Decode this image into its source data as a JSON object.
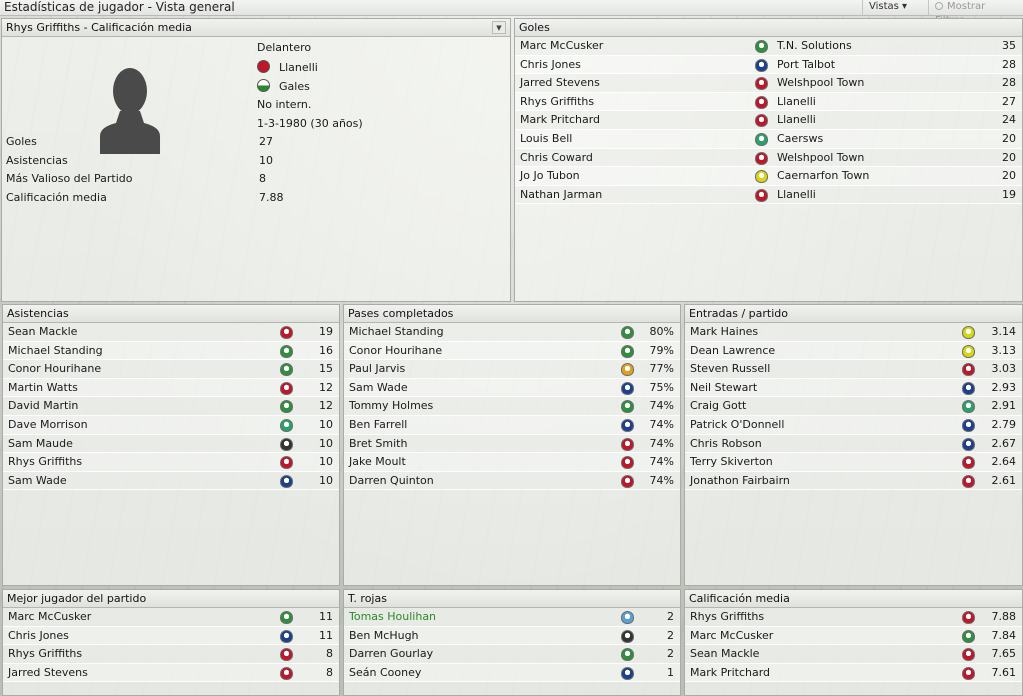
{
  "window": {
    "title": "Estadísticas de jugador - Vista general"
  },
  "toolbar": {
    "vistas_label": "Vistas ▾",
    "filters_label": "Mostrar Filtros"
  },
  "player_panel": {
    "header": "Rhys Griffiths - Calificación media",
    "position": "Delantero",
    "club": "Llanelli",
    "nation": "Gales",
    "intl": "No intern.",
    "dob": "1-3-1980 (30 años)",
    "stats": [
      {
        "label": "Goles",
        "value": "27"
      },
      {
        "label": "Asistencias",
        "value": "10"
      },
      {
        "label": "Más Valioso del Partido",
        "value": "8"
      },
      {
        "label": "Calificación media",
        "value": "7.88"
      }
    ]
  },
  "goals_panel": {
    "header": "Goles",
    "rows": [
      {
        "name": "Marc McCusker",
        "club": "T.N. Solutions",
        "value": "35",
        "color": "#2f8f3f"
      },
      {
        "name": "Chris Jones",
        "club": "Port Talbot",
        "value": "28",
        "color": "#1c3f8f"
      },
      {
        "name": "Jarred Stevens",
        "club": "Welshpool Town",
        "value": "28",
        "color": "#c0162a"
      },
      {
        "name": "Rhys Griffiths",
        "club": "Llanelli",
        "value": "27",
        "color": "#c0162a"
      },
      {
        "name": "Mark Pritchard",
        "club": "Llanelli",
        "value": "24",
        "color": "#c0162a"
      },
      {
        "name": "Louis Bell",
        "club": "Caersws",
        "value": "20",
        "color": "#2aa06a"
      },
      {
        "name": "Chris Coward",
        "club": "Welshpool Town",
        "value": "20",
        "color": "#c0162a"
      },
      {
        "name": "Jo Jo Tubon",
        "club": "Caernarfon Town",
        "value": "20",
        "color": "#d6d614"
      },
      {
        "name": "Nathan Jarman",
        "club": "Llanelli",
        "value": "19",
        "color": "#c0162a"
      }
    ]
  },
  "assists_panel": {
    "header": "Asistencias",
    "rows": [
      {
        "name": "Sean Mackle",
        "value": "19",
        "color": "#c0162a"
      },
      {
        "name": "Michael Standing",
        "value": "16",
        "color": "#2f8f3f"
      },
      {
        "name": "Conor Hourihane",
        "value": "15",
        "color": "#2f8f3f"
      },
      {
        "name": "Martin Watts",
        "value": "12",
        "color": "#c0162a"
      },
      {
        "name": "David Martin",
        "value": "12",
        "color": "#2f8f3f"
      },
      {
        "name": "Dave Morrison",
        "value": "10",
        "color": "#2aa06a"
      },
      {
        "name": "Sam Maude",
        "value": "10",
        "color": "#333333"
      },
      {
        "name": "Rhys Griffiths",
        "value": "10",
        "color": "#c0162a"
      },
      {
        "name": "Sam Wade",
        "value": "10",
        "color": "#1c3f8f"
      }
    ]
  },
  "passes_panel": {
    "header": "Pases completados",
    "rows": [
      {
        "name": "Michael Standing",
        "value": "80%",
        "color": "#2f8f3f"
      },
      {
        "name": "Conor Hourihane",
        "value": "79%",
        "color": "#2f8f3f"
      },
      {
        "name": "Paul Jarvis",
        "value": "77%",
        "color": "#e0a020"
      },
      {
        "name": "Sam Wade",
        "value": "75%",
        "color": "#1c3f8f"
      },
      {
        "name": "Tommy Holmes",
        "value": "74%",
        "color": "#2f8f3f"
      },
      {
        "name": "Ben Farrell",
        "value": "74%",
        "color": "#1c3f8f"
      },
      {
        "name": "Bret Smith",
        "value": "74%",
        "color": "#c0162a"
      },
      {
        "name": "Jake Moult",
        "value": "74%",
        "color": "#c0162a"
      },
      {
        "name": "Darren Quinton",
        "value": "74%",
        "color": "#c0162a"
      }
    ]
  },
  "tackles_panel": {
    "header": "Entradas / partido",
    "rows": [
      {
        "name": "Mark Haines",
        "value": "3.14",
        "color": "#d6d614"
      },
      {
        "name": "Dean Lawrence",
        "value": "3.13",
        "color": "#d6d614"
      },
      {
        "name": "Steven Russell",
        "value": "3.03",
        "color": "#c0162a"
      },
      {
        "name": "Neil Stewart",
        "value": "2.93",
        "color": "#1c3f8f"
      },
      {
        "name": "Craig Gott",
        "value": "2.91",
        "color": "#2aa06a"
      },
      {
        "name": "Patrick O'Donnell",
        "value": "2.79",
        "color": "#1c3f8f"
      },
      {
        "name": "Chris Robson",
        "value": "2.67",
        "color": "#1c3f8f"
      },
      {
        "name": "Terry Skiverton",
        "value": "2.64",
        "color": "#c0162a"
      },
      {
        "name": "Jonathon Fairbairn",
        "value": "2.61",
        "color": "#c0162a"
      }
    ]
  },
  "motm_panel": {
    "header": "Mejor jugador del partido",
    "rows": [
      {
        "name": "Marc McCusker",
        "value": "11",
        "color": "#2f8f3f"
      },
      {
        "name": "Chris Jones",
        "value": "11",
        "color": "#1c3f8f"
      },
      {
        "name": "Rhys Griffiths",
        "value": "8",
        "color": "#c0162a"
      },
      {
        "name": "Jarred Stevens",
        "value": "8",
        "color": "#c0162a"
      }
    ]
  },
  "red_cards_panel": {
    "header": "T. rojas",
    "rows": [
      {
        "name": "Tomas Houlihan",
        "value": "2",
        "color": "#5aa0d0",
        "highlight": true
      },
      {
        "name": "Ben McHugh",
        "value": "2",
        "color": "#333333"
      },
      {
        "name": "Darren Gourlay",
        "value": "2",
        "color": "#2f8f3f"
      },
      {
        "name": "Seán Cooney",
        "value": "1",
        "color": "#1c3f8f"
      }
    ]
  },
  "rating_panel": {
    "header": "Calificación media",
    "rows": [
      {
        "name": "Rhys Griffiths",
        "value": "7.88",
        "color": "#c0162a"
      },
      {
        "name": "Marc McCusker",
        "value": "7.84",
        "color": "#2f8f3f"
      },
      {
        "name": "Sean Mackle",
        "value": "7.65",
        "color": "#c0162a"
      },
      {
        "name": "Mark Pritchard",
        "value": "7.61",
        "color": "#c0162a"
      }
    ]
  }
}
